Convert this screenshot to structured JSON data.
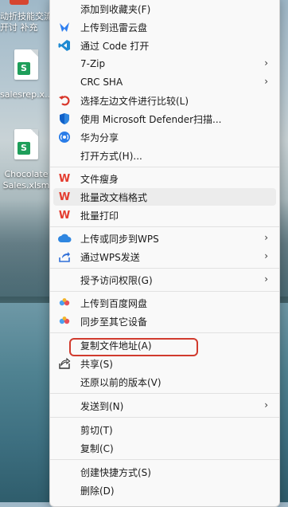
{
  "desktop": {
    "top_label": "动折技能交流",
    "top_label2": "开讨 补充",
    "icons": [
      {
        "label": "salesrep.x...",
        "badge": "S"
      },
      {
        "label": "Chocolate",
        "label2": "Sales.xlsm",
        "badge": "S"
      }
    ]
  },
  "menu": {
    "add_favorites": "添加到收藏夹(F)",
    "upload_xunlei": "上传到迅雷云盘",
    "open_code": "通过 Code 打开",
    "zip": "7-Zip",
    "crc": "CRC SHA",
    "compare": "选择左边文件进行比较(L)",
    "defender": "使用 Microsoft Defender扫描...",
    "huawei_share": "华为分享",
    "open_with": "打开方式(H)...",
    "slim": "文件瘦身",
    "batch_format": "批量改文档格式",
    "batch_print": "批量打印",
    "wps_sync": "上传或同步到WPS",
    "wps_send": "通过WPS发送",
    "grant_access": "授予访问权限(G)",
    "baidu_upload": "上传到百度网盘",
    "sync_devices": "同步至其它设备",
    "copy_path": "复制文件地址(A)",
    "share": "共享(S)",
    "restore": "还原以前的版本(V)",
    "send_to": "发送到(N)",
    "cut": "剪切(T)",
    "copy": "复制(C)",
    "shortcut": "创建快捷方式(S)",
    "delete": "删除(D)"
  },
  "icons": {
    "chevron": "›"
  },
  "colors": {
    "accent_red": "#d13b2e",
    "wps_red": "#e43c2f"
  }
}
